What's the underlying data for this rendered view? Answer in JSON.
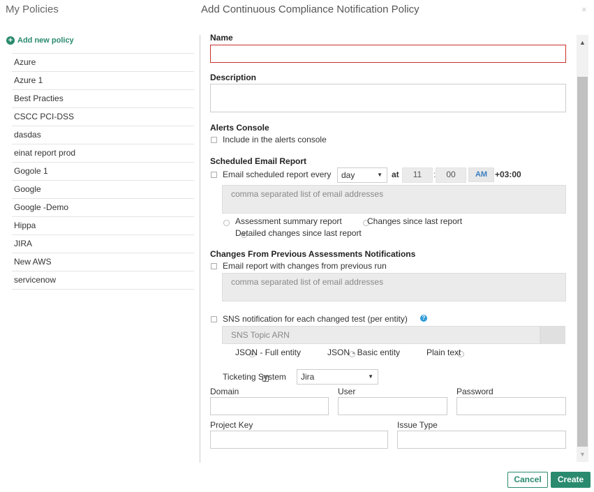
{
  "page_title": "My Policies",
  "dialog_title": "Add Continuous Compliance Notification Policy",
  "close_glyph": "×",
  "sidebar": {
    "add_label": "Add new policy",
    "items": [
      "Azure",
      "Azure 1",
      "Best Practies",
      "CSCC PCI-DSS",
      "dasdas",
      "einat report prod",
      "Gogole 1",
      "Google",
      "Google -Demo",
      "Hippa",
      "JIRA",
      "New AWS",
      "servicenow"
    ]
  },
  "form": {
    "name_label": "Name",
    "name_value": "",
    "description_label": "Description",
    "description_value": "",
    "alerts_console": {
      "title": "Alerts Console",
      "checkbox_label": "Include in the alerts console",
      "checked": false
    },
    "scheduled": {
      "title": "Scheduled Email Report",
      "checkbox_label": "Email scheduled report every",
      "checked": false,
      "frequency": "day",
      "at_label": "at",
      "hour": "11",
      "minute": "00",
      "time_separator": ":",
      "ampm": "AM",
      "timezone": "+03:00",
      "email_placeholder": "comma separated list of email addresses",
      "report_options": [
        {
          "label": "Assessment summary report",
          "selected": false
        },
        {
          "label": "Changes since last report",
          "selected": false
        },
        {
          "label": "Detailed changes since last report",
          "selected": true
        }
      ]
    },
    "changes": {
      "title": "Changes From Previous Assessments Notifications",
      "checkbox_label": "Email report with changes from previous run",
      "checked": false,
      "email_placeholder": "comma separated list of email addresses"
    },
    "sns": {
      "checkbox_label": "SNS notification for each changed test (per entity)",
      "checked": false,
      "help_glyph": "?",
      "topic_placeholder": "SNS Topic ARN",
      "format_options": [
        {
          "label": "JSON - Full entity",
          "selected": true
        },
        {
          "label": "JSON - Basic entity",
          "selected": false
        },
        {
          "label": "Plain text",
          "selected": false
        }
      ]
    },
    "ticketing": {
      "checkbox_label": "Ticketing System",
      "checked": true,
      "system": "Jira",
      "domain_label": "Domain",
      "user_label": "User",
      "password_label": "Password",
      "project_key_label": "Project Key",
      "issue_type_label": "Issue Type"
    }
  },
  "buttons": {
    "cancel": "Cancel",
    "create": "Create"
  },
  "colors": {
    "accent": "#2a8a6e",
    "error_border": "#c9302c",
    "help": "#2f9ad6"
  }
}
